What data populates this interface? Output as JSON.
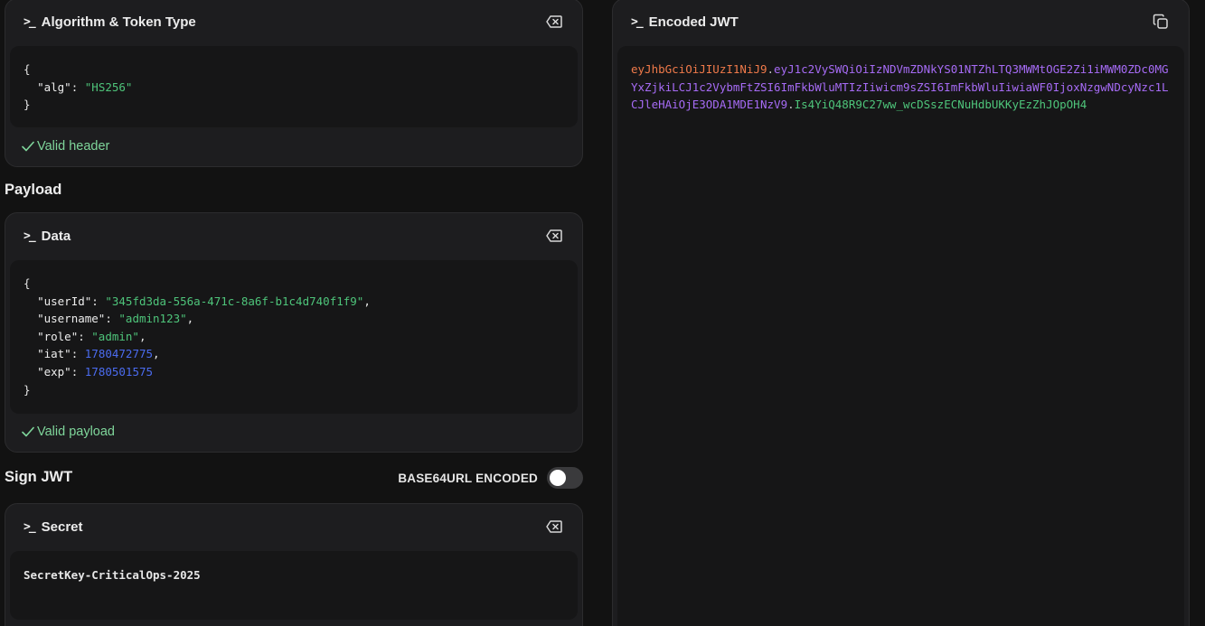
{
  "header_card": {
    "title": "Algorithm & Token Type",
    "json_lines": {
      "open": "{",
      "alg_key": "\"alg\"",
      "alg_value": "\"HS256\"",
      "close": "}"
    },
    "status": "Valid header"
  },
  "payload": {
    "section_label": "Payload",
    "card_title": "Data",
    "json": {
      "open": "{",
      "userId_key": "\"userId\"",
      "userId_value": "\"345fd3da-556a-471c-8a6f-b1c4d740f1f9\"",
      "username_key": "\"username\"",
      "username_value": "\"admin123\"",
      "role_key": "\"role\"",
      "role_value": "\"admin\"",
      "iat_key": "\"iat\"",
      "iat_value": "1780472775",
      "exp_key": "\"exp\"",
      "exp_value": "1780501575",
      "close": "}"
    },
    "status": "Valid payload"
  },
  "sign": {
    "section_label": "Sign JWT",
    "toggle_label": "BASE64URL ENCODED",
    "toggle_on": false,
    "card_title": "Secret",
    "secret_value": "SecretKey-CriticalOps-2025"
  },
  "encoded": {
    "title": "Encoded JWT",
    "header_part": "eyJhbGciOiJIUzI1NiJ9",
    "payload_part": "eyJ1c2VySWQiOiIzNDVmZDNkYS01NTZhLTQ3MWMtOGE2Zi1iMWM0ZDc0MGYxZjkiLCJ1c2VybmFtZSI6ImFkbWluMTIzIiwicm9sZSI6ImFkbWluIiwiaWF0IjoxNzgwNDcyNzc1LCJleHAiOjE3ODA1MDE1NzV9",
    "signature_part": "Is4YiQ48R9C27ww_wcDSszECNuHdbUKKyEzZhJOpOH4",
    "dot": "."
  },
  "icons": {
    "clear": "clear-input-icon",
    "copy": "copy-icon",
    "check": "check-icon",
    "prompt": "terminal-prompt-icon"
  },
  "colors": {
    "background": "#121212",
    "card": "#1d1d1f",
    "editor": "#161617",
    "valid": "#7fd69b",
    "string": "#4ec47a",
    "number": "#4b6cf0",
    "jwt_header": "#f07a4a",
    "jwt_payload": "#a66bf5",
    "jwt_signature": "#4ec47a"
  }
}
